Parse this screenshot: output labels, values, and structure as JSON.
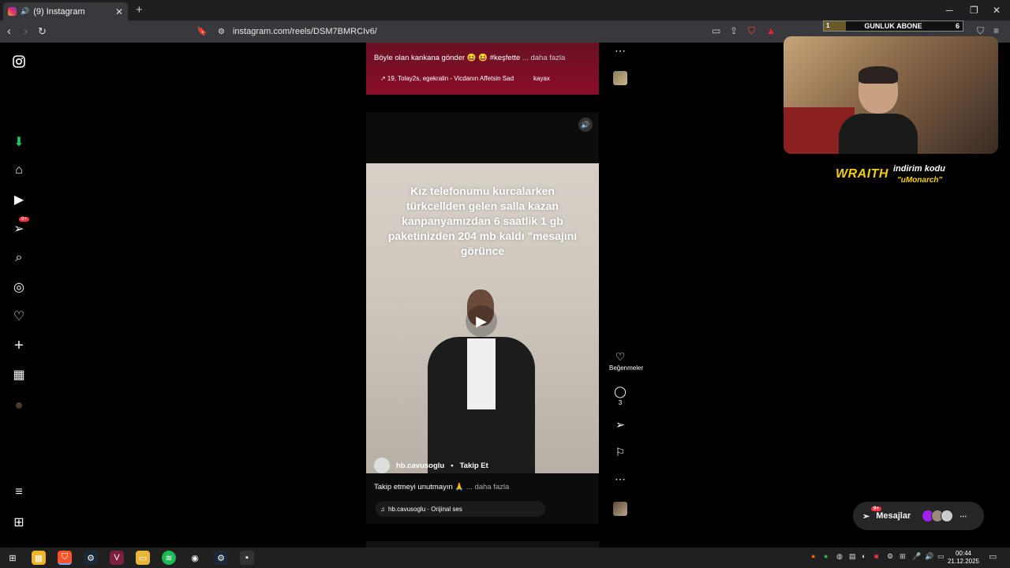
{
  "browser": {
    "tab_title": "(9) Instagram",
    "new_tab": "+",
    "url": "instagram.com/reels/DSM7BMRCIv6/"
  },
  "sidebar": {
    "notifications_badge": "9+"
  },
  "reel_top": {
    "caption": "Böyle olan kankana gönder 😆 😆 #keşfette",
    "caption_more": "... daha fazla",
    "audio": "↗ 19, Tolay2s, egekralin - Vicdanın Affetsin Sad",
    "audio_user": "kayax"
  },
  "reel_main": {
    "overlay_text": "Kız telefonumu kurcalarken türkcellden gelen salla kazan kanpanyamızdan 6 saatlik 1 gb paketinizden 204 mb kaldı \"mesajını görünce",
    "author": "hb.cavusoglu",
    "follow": "Takip Et",
    "caption": "Takip etmeyi unutmayın 🙏",
    "caption_more": "... daha fazla",
    "audio": "hb.cavusoglu · Orijinal ses"
  },
  "actions": {
    "like_label": "Beğenmeler",
    "comments_count": "3"
  },
  "stream_overlay": {
    "abone_label": "GUNLUK ABONE",
    "abone_left": "1",
    "abone_right": "6",
    "brand": "WRAITH",
    "discount_label": "indirim kodu",
    "discount_code": "\"uMonarch\""
  },
  "messages": {
    "label": "Mesajlar",
    "badge": "9+"
  },
  "taskbar": {
    "time": "00:44",
    "date": "21.12.2025"
  },
  "colors": {
    "accent_like": "#ff3040",
    "brand_yellow": "#f5d000"
  }
}
